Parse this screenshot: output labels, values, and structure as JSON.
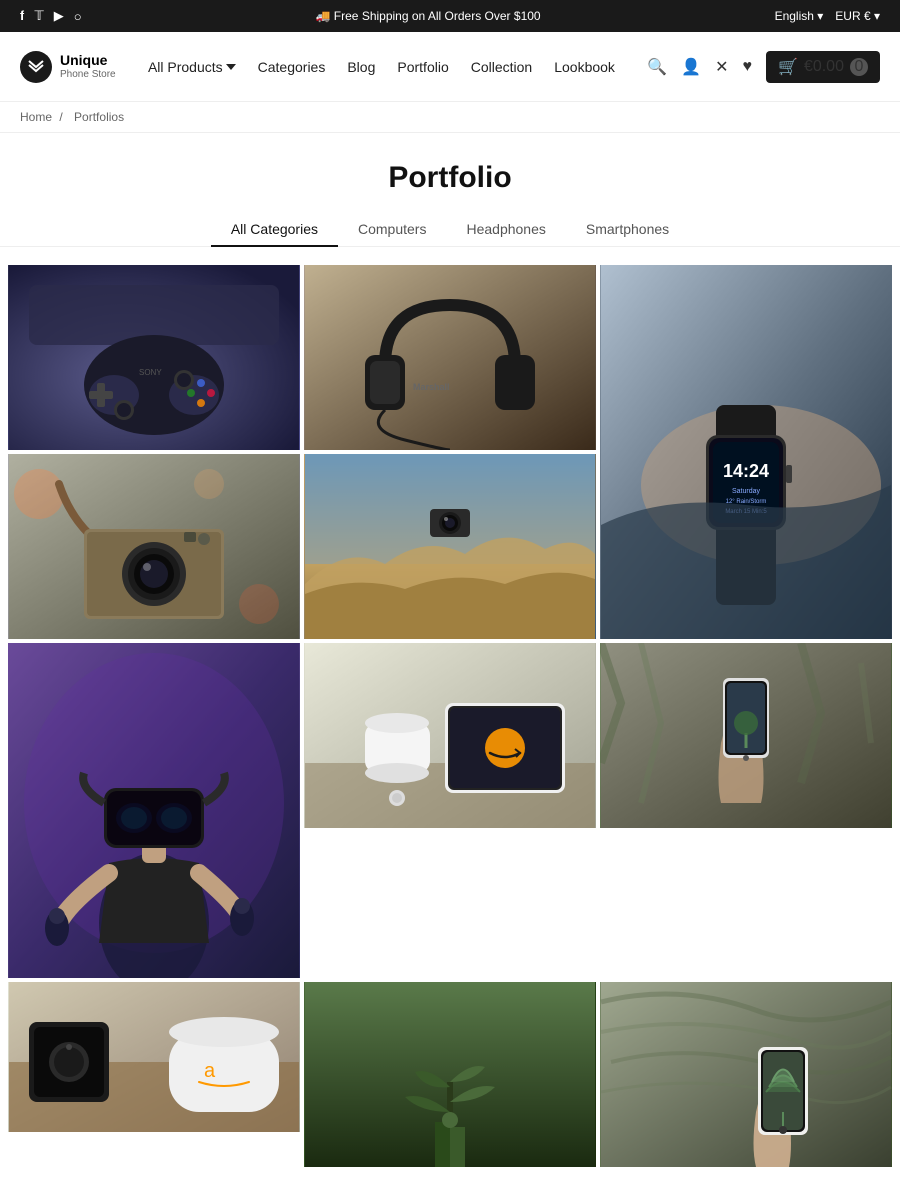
{
  "topbar": {
    "shipping_text": "🚚 Free Shipping on All Orders Over $100",
    "language": "English ▾",
    "currency": "EUR € ▾",
    "social": [
      "f",
      "t",
      "▶",
      "◉"
    ]
  },
  "header": {
    "logo_name": "Unique",
    "logo_sub": "Phone Store",
    "nav": [
      {
        "label": "All Products",
        "has_dropdown": true
      },
      {
        "label": "Categories",
        "has_dropdown": false
      },
      {
        "label": "Blog",
        "has_dropdown": false
      },
      {
        "label": "Portfolio",
        "has_dropdown": false
      },
      {
        "label": "Collection",
        "has_dropdown": false
      },
      {
        "label": "Lookbook",
        "has_dropdown": false
      }
    ],
    "cart_price": "€0.00",
    "cart_count": "0"
  },
  "breadcrumb": {
    "home": "Home",
    "separator": "/",
    "current": "Portfolios"
  },
  "page": {
    "title": "Portfolio"
  },
  "filter_tabs": [
    {
      "label": "All Categories",
      "active": true
    },
    {
      "label": "Computers",
      "active": false
    },
    {
      "label": "Headphones",
      "active": false
    },
    {
      "label": "Smartphones",
      "active": false
    }
  ],
  "gallery": {
    "items": [
      {
        "id": 1,
        "alt": "Sony PlayStation controller",
        "color_class": "bg-gamepad",
        "emoji": "🎮"
      },
      {
        "id": 2,
        "alt": "Marshall headphones",
        "color_class": "bg-headphones",
        "emoji": "🎧"
      },
      {
        "id": 3,
        "alt": "Apple Watch on wrist",
        "color_class": "bg-watch",
        "emoji": "⌚"
      },
      {
        "id": 4,
        "alt": "Vintage film camera",
        "color_class": "bg-camera",
        "emoji": "📷"
      },
      {
        "id": 5,
        "alt": "Camera floating over desert",
        "color_class": "bg-drone",
        "emoji": "📸"
      },
      {
        "id": 6,
        "alt": "Man using VR headset",
        "color_class": "bg-vr",
        "emoji": "🥽"
      },
      {
        "id": 7,
        "alt": "Tablet and accessories",
        "color_class": "bg-tablet",
        "emoji": "📱"
      },
      {
        "id": 8,
        "alt": "Phone in hand",
        "color_class": "bg-phone",
        "emoji": "📲"
      },
      {
        "id": 9,
        "alt": "Plant closeup",
        "color_class": "bg-plant",
        "emoji": "🌿"
      }
    ]
  }
}
